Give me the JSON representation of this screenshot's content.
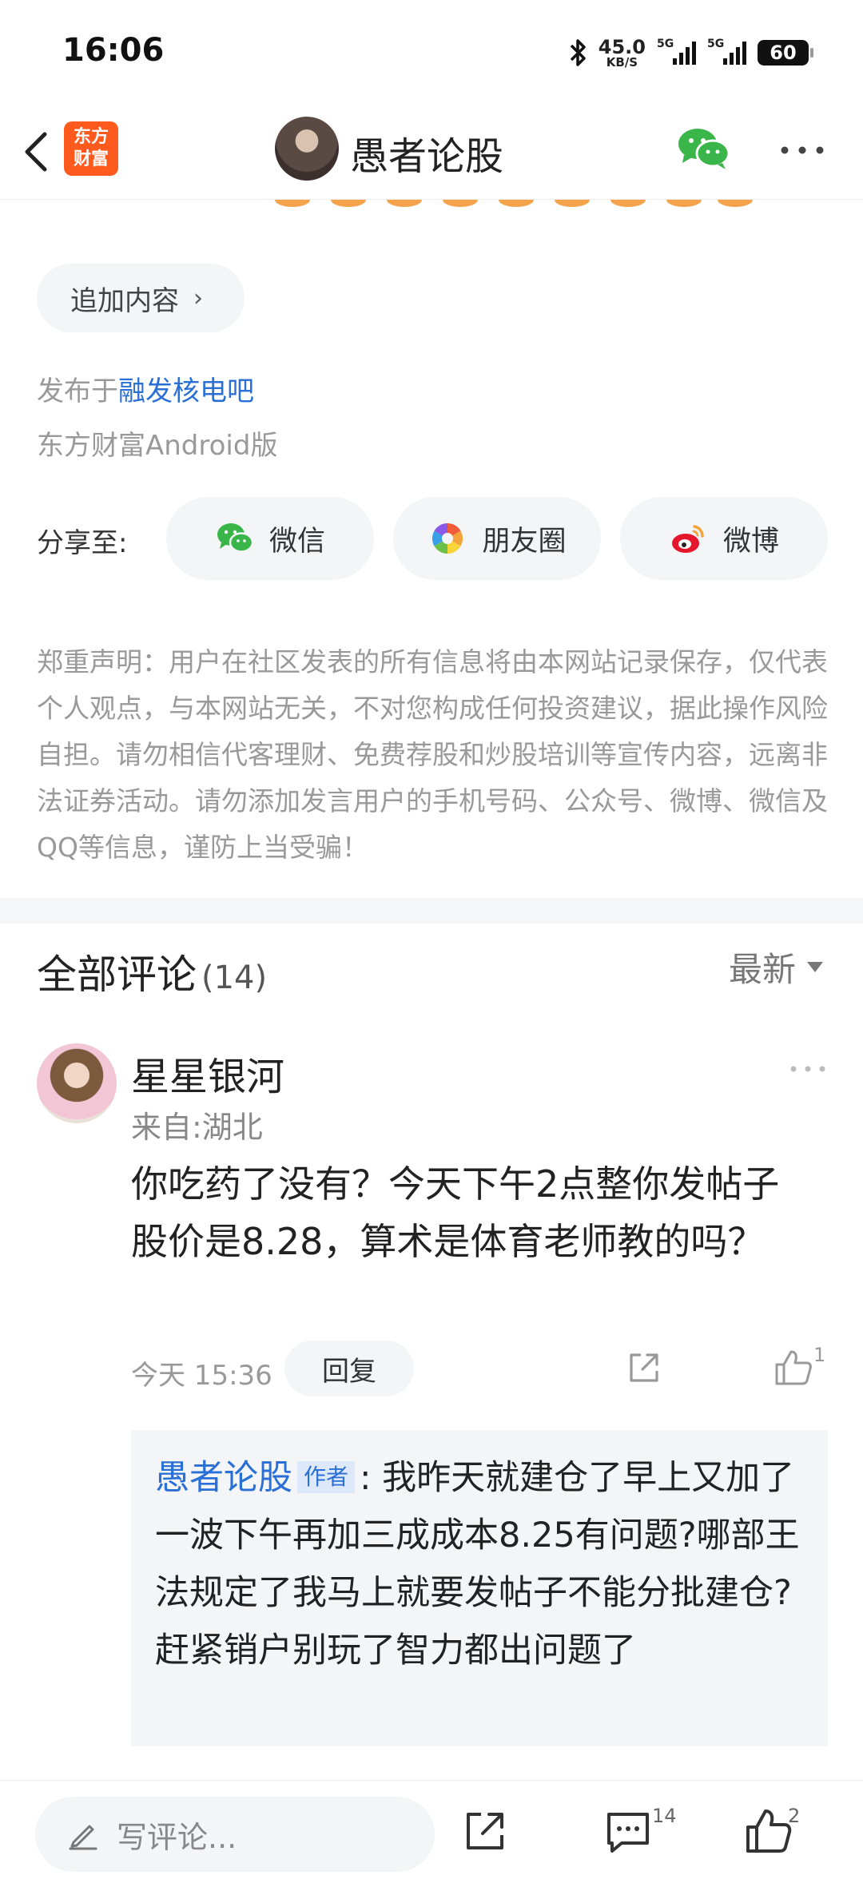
{
  "status_bar": {
    "time": "16:06",
    "net_speed_value": "45.0",
    "net_speed_unit": "KB/S",
    "sim1_label": "5G",
    "sim2_label": "5G",
    "battery": "60",
    "icons": [
      "bluetooth-icon",
      "signal-icon",
      "signal-icon",
      "battery-icon"
    ]
  },
  "header": {
    "logo_line1": "东方",
    "logo_line2": "财富",
    "title": "愚者论股",
    "icons": [
      "back-icon",
      "wechat-icon",
      "more-icon"
    ]
  },
  "post_footer": {
    "add_content_label": "追加内容",
    "published_prefix": "发布于",
    "published_board": "融发核电吧",
    "client": "东方财富Android版"
  },
  "share": {
    "label": "分享至:",
    "options": [
      {
        "label": "微信",
        "icon": "wechat-icon",
        "color": "#3ab54a"
      },
      {
        "label": "朋友圈",
        "icon": "moments-icon",
        "color": "#f2a33a"
      },
      {
        "label": "微博",
        "icon": "weibo-icon",
        "color": "#e6162d"
      }
    ]
  },
  "disclaimer": "郑重声明：用户在社区发表的所有信息将由本网站记录保存，仅代表个人观点，与本网站无关，不对您构成任何投资建议，据此操作风险自担。请勿相信代客理财、免费荐股和炒股培训等宣传内容，远离非法证券活动。请勿添加发言用户的手机号码、公众号、微博、微信及QQ等信息，谨防上当受骗！",
  "comments": {
    "title": "全部评论",
    "count": "(14)",
    "sort": "最新",
    "items": [
      {
        "user": "星星银河",
        "location": "来自:湖北",
        "body": "你吃药了没有？今天下午2点整你发帖子股价是8.28，算术是体育老师教的吗？",
        "time": "今天 15:36",
        "reply_label": "回复",
        "likes": "1",
        "reply": {
          "author": "愚者论股",
          "tag": "作者",
          "text": ": 我昨天就建仓了早上又加了一波下午再加三成成本8.25有问题?哪部王法规定了我马上就要发帖子不能分批建仓?赶紧销户别玩了智力都出问题了"
        }
      }
    ]
  },
  "bottom_bar": {
    "input_placeholder": "写评论...",
    "comment_count": "14",
    "like_count": "2"
  },
  "colors": {
    "link": "#2a6fd6",
    "brand": "#ff5a1e",
    "wechat": "#3ab54a"
  }
}
